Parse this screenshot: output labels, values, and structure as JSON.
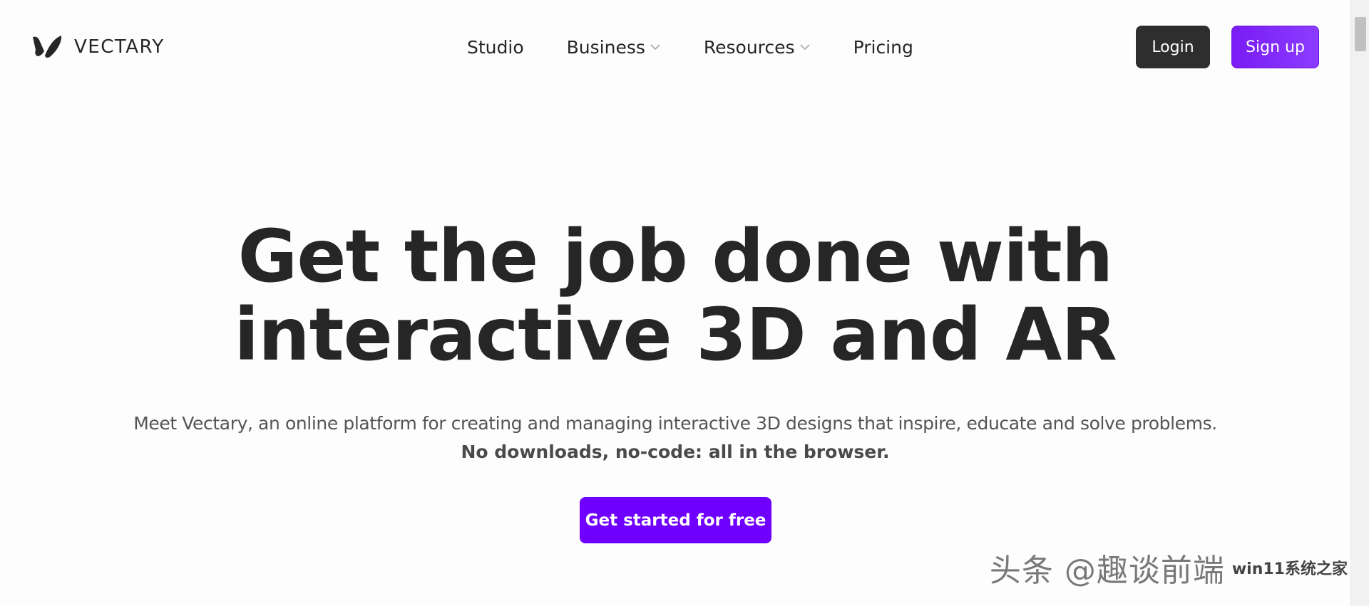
{
  "brand": {
    "name": "VECTARY",
    "logo_icon": "vectary-v-logo-icon"
  },
  "nav": {
    "items": [
      {
        "label": "Studio",
        "has_dropdown": false
      },
      {
        "label": "Business",
        "has_dropdown": true
      },
      {
        "label": "Resources",
        "has_dropdown": true
      },
      {
        "label": "Pricing",
        "has_dropdown": false
      }
    ]
  },
  "auth": {
    "login_label": "Login",
    "signup_label": "Sign up"
  },
  "hero": {
    "title_line1": "Get the job done with",
    "title_line2": "interactive 3D and AR",
    "subtitle": "Meet Vectary, an online platform for creating and managing interactive 3D designs that inspire, educate and solve problems.",
    "subtitle_bold": "No downloads, no-code: all in the browser.",
    "cta_label": "Get started for free"
  },
  "watermark": {
    "text": "头条 @趣谈前端",
    "site": "win11系统之家"
  },
  "colors": {
    "text": "#262626",
    "login_bg": "#2e2e2e",
    "signup_bg": "#7a1cf5",
    "cta_bg": "#6f00ff",
    "page_bg": "#fdfdfd"
  }
}
